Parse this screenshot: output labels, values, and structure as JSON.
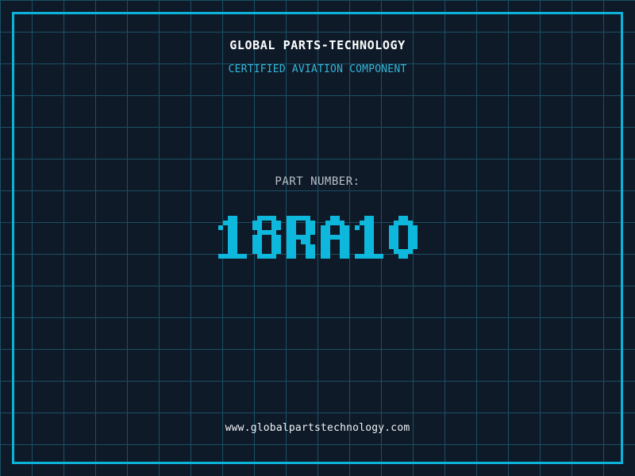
{
  "theme": {
    "background": "#0f1a29",
    "grid_line": "#1a4f63",
    "frame": "#0db2d8",
    "title_color": "#ffffff",
    "subtitle_color": "#33b5d6",
    "label_color": "#b7c0c8",
    "number_color": "#0db8dc",
    "url_color": "#eef2f5"
  },
  "header": {
    "title": "GLOBAL PARTS-TECHNOLOGY",
    "subtitle": "CERTIFIED AVIATION COMPONENT"
  },
  "part": {
    "label": "PART NUMBER:",
    "number": "18RA10"
  },
  "footer": {
    "url": "www.globalpartstechnology.com"
  }
}
